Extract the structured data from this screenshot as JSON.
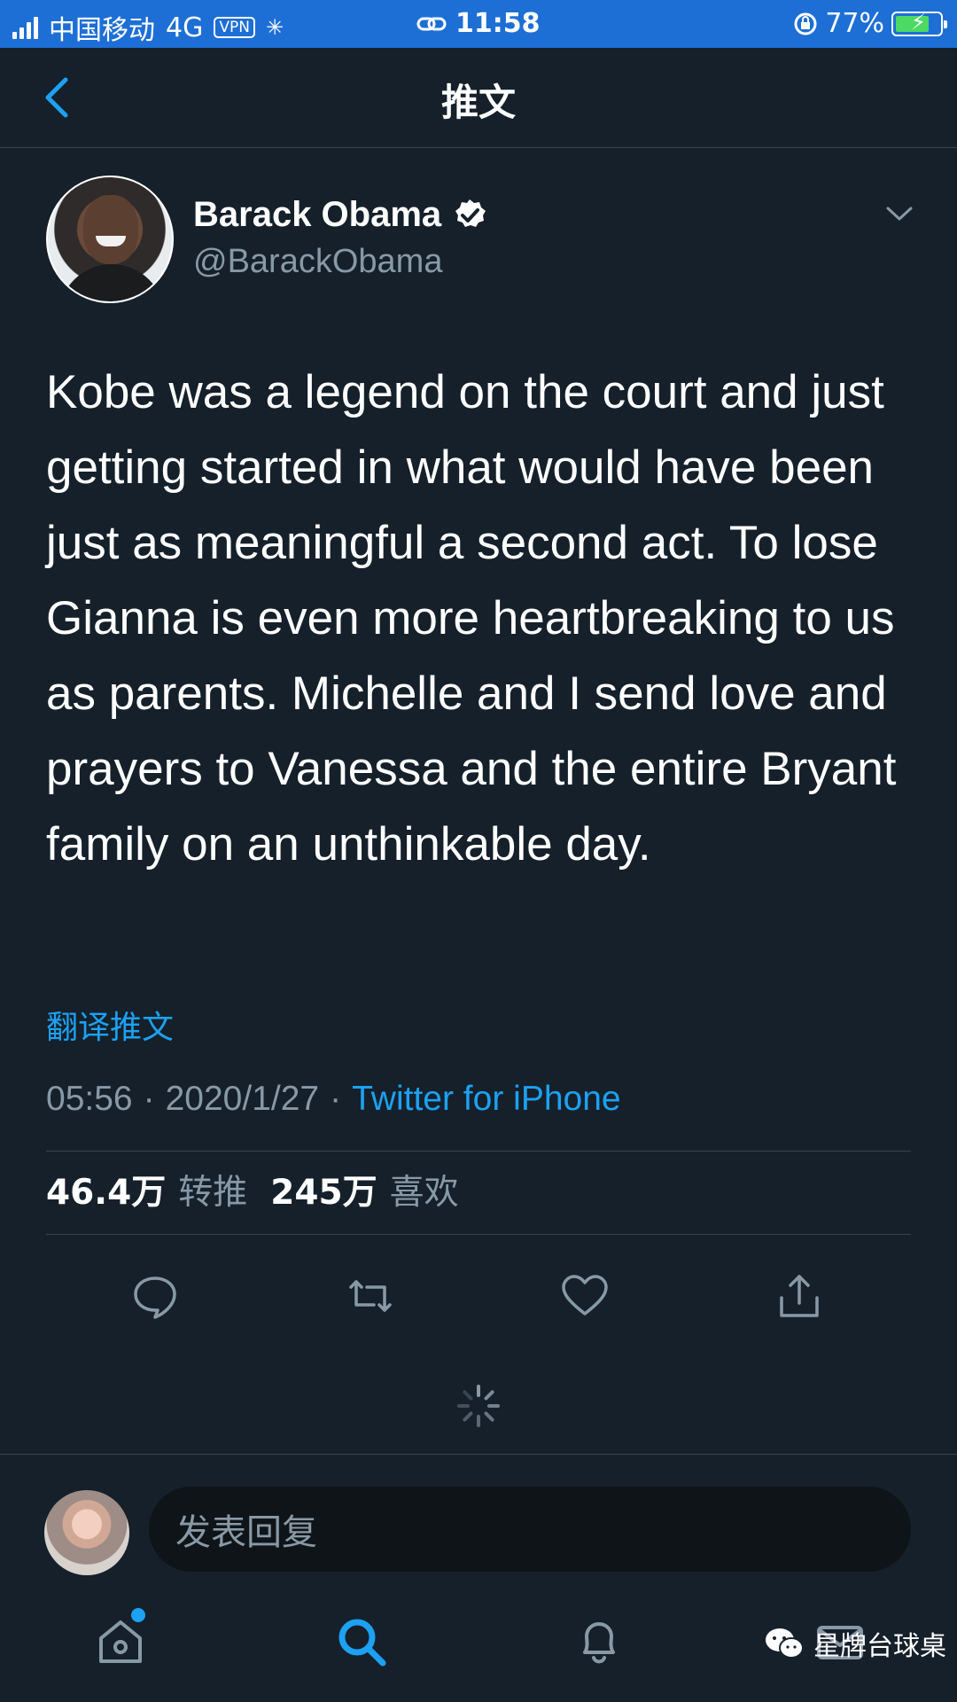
{
  "status_bar": {
    "carrier": "中国移动",
    "network": "4G",
    "vpn": "VPN",
    "time": "11:58",
    "battery": "77%",
    "battery_level": 0.77
  },
  "nav": {
    "title": "推文"
  },
  "tweet": {
    "display_name": "Barack Obama",
    "handle": "@BarackObama",
    "text": "Kobe was a legend on the court and just getting started in what would have been just as meaningful a second act. To lose Gianna is even more heartbreaking to us as parents. Michelle and I send love and prayers to Vanessa and the entire Bryant family on an unthinkable day.",
    "translate": "翻译推文",
    "time": "05:56",
    "date": "2020/1/27",
    "separator": "·",
    "source": "Twitter for iPhone",
    "retweets_count": "46.4万",
    "retweets_label": "转推",
    "likes_count": "245万",
    "likes_label": "喜欢"
  },
  "actions": {
    "reply_icon": "comment-icon",
    "retweet_icon": "retweet-icon",
    "like_icon": "heart-icon",
    "share_icon": "share-icon"
  },
  "reply": {
    "placeholder": "发表回复"
  },
  "tabbar": {
    "items": [
      "home-icon",
      "search-icon",
      "notifications-icon",
      "messages-icon"
    ]
  },
  "watermark": {
    "text": "星牌台球桌"
  },
  "colors": {
    "background": "#15202b",
    "accent": "#1da1f2",
    "status_bar": "#1d6fd6",
    "muted": "#8899a6"
  }
}
